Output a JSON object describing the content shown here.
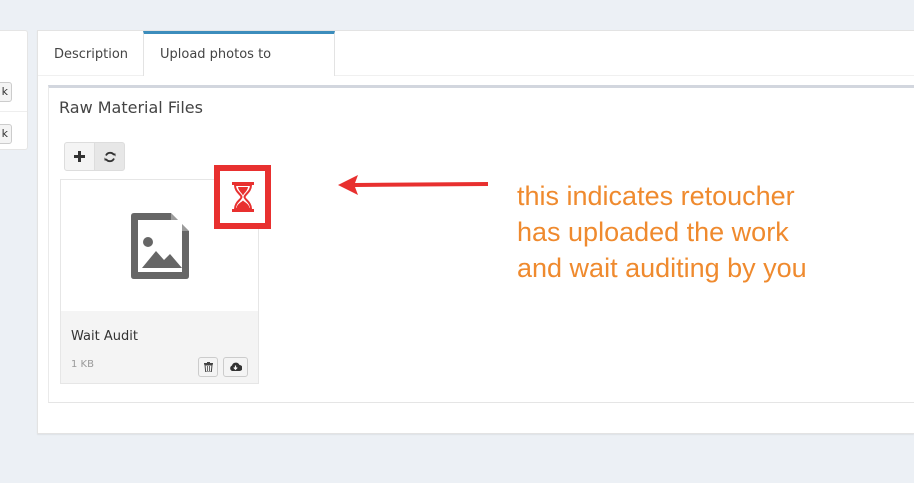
{
  "left_panel": {
    "buttons": [
      "k",
      "k"
    ]
  },
  "tabs": [
    {
      "label": "Description",
      "active": false
    },
    {
      "label": "Upload photos to retoucher",
      "active": true
    }
  ],
  "section": {
    "title": "Raw Material Files"
  },
  "toolbar": {
    "add_icon": "plus-icon",
    "refresh_icon": "refresh-icon"
  },
  "file": {
    "name": "Wait Audit",
    "size": "1 KB",
    "thumbnail_icon": "image-file-icon",
    "status_icon": "hourglass-icon"
  },
  "annotation": {
    "lines": [
      "this indicates retoucher",
      "has uploaded the work",
      "and wait auditing by you"
    ]
  },
  "colors": {
    "accent": "#3c8dbc",
    "annotation": "#ef8a2e",
    "highlight": "#e8302f",
    "background": "#ecf0f5"
  }
}
